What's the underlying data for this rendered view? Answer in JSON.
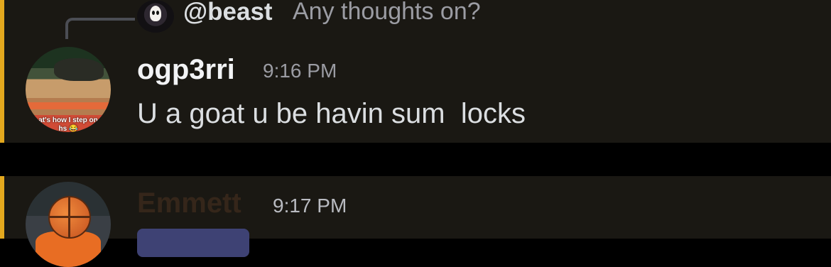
{
  "reply": {
    "username": "@beast",
    "text": "Any thoughts on?"
  },
  "messages": [
    {
      "username": "ogp3rri",
      "timestamp": "9:16 PM",
      "text": "U a goat u be havin sum  locks",
      "avatar_caption": "at's how I step on\nhs 😂"
    },
    {
      "username": "Emmett",
      "timestamp": "9:17 PM"
    }
  ],
  "colors": {
    "background": "#1a1813",
    "mention_bar": "#e3a81e",
    "separator": "#000000",
    "username": "#f2f3f5",
    "timestamp": "#9b9ca3",
    "mention_pill": "#3e4274"
  },
  "icons": {
    "reply_avatar": "ghostface-avatar-icon",
    "avatar1": "basketball-player-avatar",
    "avatar2": "basketball-head-avatar"
  }
}
